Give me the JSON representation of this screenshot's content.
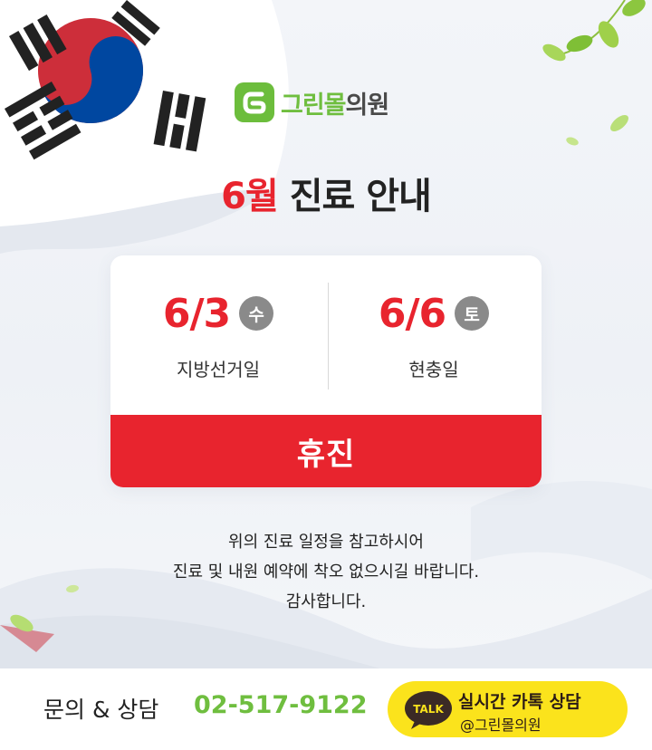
{
  "brand": {
    "name_green": "그린몰",
    "name_dark": "의원",
    "colors": {
      "green": "#6fbe3f",
      "red": "#e8242e",
      "kakao_yellow": "#fbe31c"
    }
  },
  "headline": {
    "month": "6월",
    "title": "진료 안내"
  },
  "schedule": {
    "days": [
      {
        "date": "6/3",
        "weekday": "수",
        "holiday": "지방선거일"
      },
      {
        "date": "6/6",
        "weekday": "토",
        "holiday": "현충일"
      }
    ],
    "status": "휴진"
  },
  "notice": {
    "lines": [
      "위의 진료 일정을 참고하시어",
      "진료 및 내원 예약에 착오 없으시길 바랍니다.",
      "감사합니다."
    ]
  },
  "footer": {
    "inquiry_label": "문의 & 상담",
    "phone": "02-517-9122",
    "kakao": {
      "icon_text": "TALK",
      "title": "실시간 카톡 상담",
      "channel": "@그린몰의원"
    }
  },
  "icons": [
    "korean-flag-icon",
    "logo-mark-icon",
    "leaf-icon",
    "kakao-talk-icon"
  ]
}
